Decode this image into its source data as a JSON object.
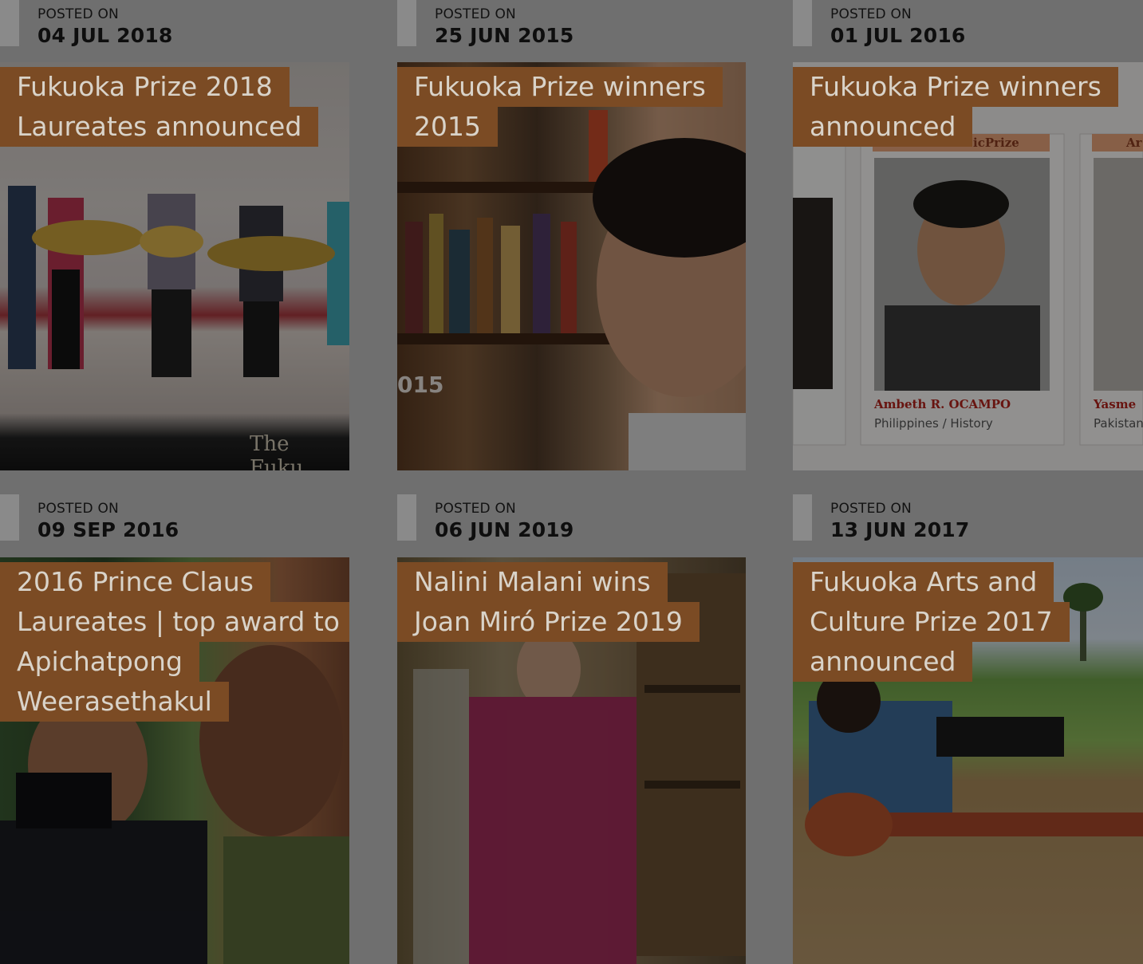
{
  "posts": [
    {
      "posted_label": "POSTED ON",
      "date": "04 JUL 2018",
      "title_lines": [
        "Fukuoka Prize 2018",
        "Laureates announced"
      ],
      "image_caption": "The Fuku",
      "image_subject": "stage-ceremony-photo"
    },
    {
      "posted_label": "POSTED ON",
      "date": "25 JUN 2015",
      "title_lines": [
        "Fukuoka Prize winners",
        "2015"
      ],
      "image_caption": "015",
      "image_subject": "portrait-bookshelf-photo"
    },
    {
      "posted_label": "POSTED ON",
      "date": "01 JUL 2016",
      "title_lines": [
        "Fukuoka Prize winners",
        "announced"
      ],
      "image_caption": "Ambeth R. OCAMPO",
      "image_caption_sub": "Philippines / History",
      "image_caption_2": "Yasme",
      "image_caption_2_sub": "Pakistan",
      "image_tab": "icPrize",
      "image_tab_2": "Ar",
      "image_subject": "laureate-cards-photo"
    },
    {
      "posted_label": "POSTED ON",
      "date": "09 SEP 2016",
      "title_lines": [
        "2016 Prince Claus",
        "Laureates | top award to",
        "Apichatpong",
        "Weerasethakul"
      ],
      "image_subject": "film-crew-photo"
    },
    {
      "posted_label": "POSTED ON",
      "date": "06 JUN 2019",
      "title_lines": [
        "Nalini Malani wins",
        "Joan Miró Prize 2019"
      ],
      "image_subject": "artist-studio-photo"
    },
    {
      "posted_label": "POSTED ON",
      "date": "13 JUN 2017",
      "title_lines": [
        "Fukuoka Arts and",
        "Culture Prize 2017",
        "announced"
      ],
      "image_subject": "musician-instrument-photo"
    }
  ],
  "colors": {
    "overlay": "#6f6f6f",
    "title_bg": "#7b4b24",
    "title_text": "#d9d3c9",
    "date_text": "#0e0e0e",
    "accent_bar": "#8a8a8a"
  }
}
